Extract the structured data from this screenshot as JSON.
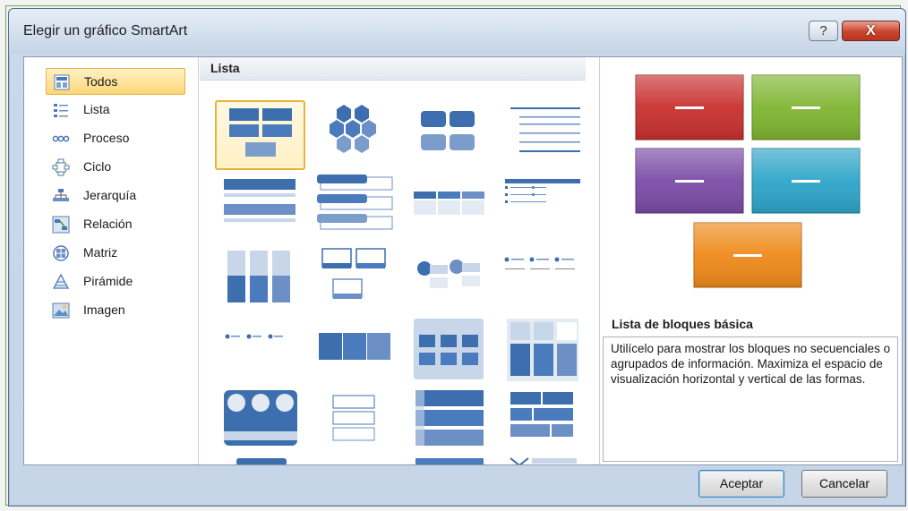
{
  "window": {
    "title": "Elegir un gráfico SmartArt",
    "help_label": "?",
    "close_label": "X"
  },
  "categories": [
    {
      "label": "Todos",
      "icon": "all-layouts-icon",
      "selected": true
    },
    {
      "label": "Lista",
      "icon": "list-icon"
    },
    {
      "label": "Proceso",
      "icon": "process-icon"
    },
    {
      "label": "Ciclo",
      "icon": "cycle-icon"
    },
    {
      "label": "Jerarquía",
      "icon": "hierarchy-icon"
    },
    {
      "label": "Relación",
      "icon": "relationship-icon"
    },
    {
      "label": "Matriz",
      "icon": "matrix-icon"
    },
    {
      "label": "Pirámide",
      "icon": "pyramid-icon"
    },
    {
      "label": "Imagen",
      "icon": "picture-icon"
    }
  ],
  "gallery": {
    "title": "Lista"
  },
  "preview": {
    "title": "Lista de bloques básica",
    "description": "Utilícelo para mostrar los bloques no secuenciales o agrupados de información. Maximiza el espacio de visualización horizontal y vertical de las formas.",
    "colors": [
      "#c8302f",
      "#80b531",
      "#7b4ba5",
      "#2ea5c9",
      "#ef8a1a"
    ]
  },
  "buttons": {
    "ok": "Aceptar",
    "cancel": "Cancelar"
  }
}
